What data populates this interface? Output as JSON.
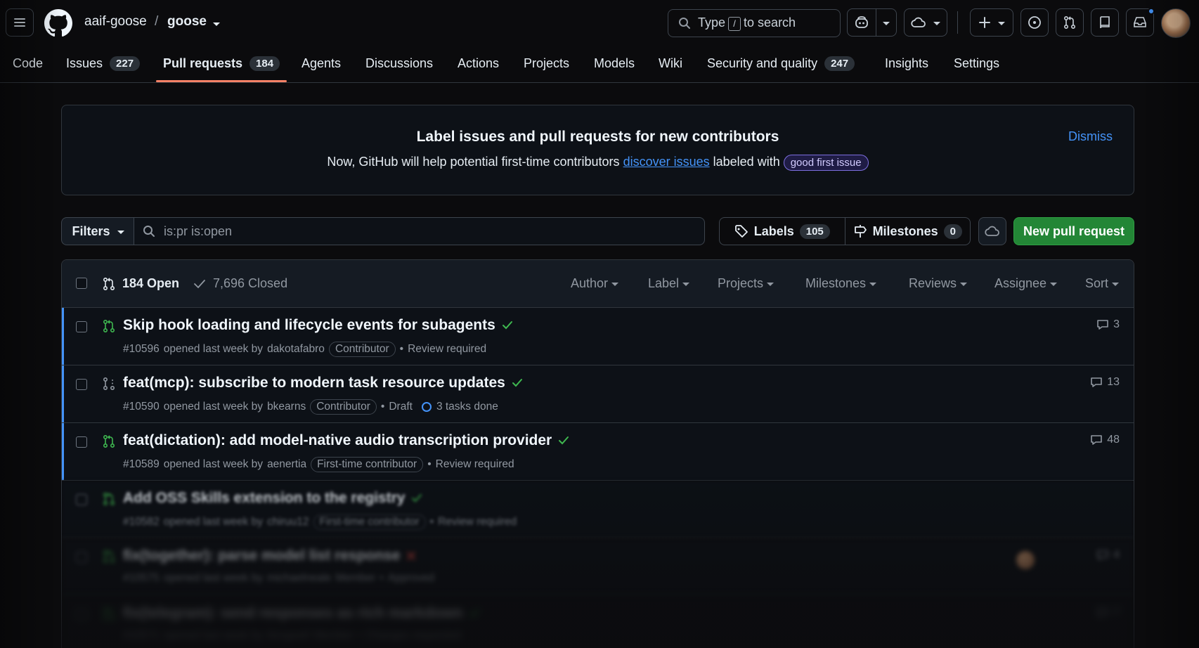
{
  "header": {
    "owner": "aaif-goose",
    "separator": "/",
    "repo": "goose",
    "search_prefix": "Type",
    "search_key": "/",
    "search_suffix": "to search"
  },
  "nav": {
    "items": [
      {
        "label": "Code"
      },
      {
        "label": "Issues",
        "count": "227"
      },
      {
        "label": "Pull requests",
        "count": "184"
      },
      {
        "label": "Agents"
      },
      {
        "label": "Discussions"
      },
      {
        "label": "Actions"
      },
      {
        "label": "Projects"
      },
      {
        "label": "Models"
      },
      {
        "label": "Wiki"
      },
      {
        "label": "Security and quality",
        "count": "247"
      },
      {
        "label": "Insights"
      },
      {
        "label": "Settings"
      }
    ]
  },
  "banner": {
    "title": "Label issues and pull requests for new contributors",
    "text_before": "Now, GitHub will help potential first-time contributors",
    "link": "discover issues",
    "text_after": "labeled with",
    "label": "good first issue",
    "dismiss": "Dismiss"
  },
  "filters": {
    "button": "Filters",
    "query": "is:pr is:open",
    "labels_label": "Labels",
    "labels_count": "105",
    "milestones_label": "Milestones",
    "milestones_count": "0",
    "new_pr": "New pull request"
  },
  "list_header": {
    "open": "184 Open",
    "closed": "7,696 Closed",
    "filters": [
      "Author",
      "Label",
      "Projects",
      "Milestones",
      "Reviews",
      "Assignee",
      "Sort"
    ]
  },
  "pull_requests": [
    {
      "title": "Skip hook loading and lifecycle events for subagents",
      "number": "#10596",
      "opened": "opened last week by",
      "author": "dakotafabro",
      "association": "Contributor",
      "status": "Review required",
      "extra": "",
      "comments": "3",
      "state": "open",
      "check": "pass"
    },
    {
      "title": "feat(mcp): subscribe to modern task resource updates",
      "number": "#10590",
      "opened": "opened last week by",
      "author": "bkearns",
      "association": "Contributor",
      "status": "Draft",
      "extra": "3 tasks done",
      "comments": "13",
      "state": "draft",
      "check": "pass"
    },
    {
      "title": "feat(dictation): add model-native audio transcription provider",
      "number": "#10589",
      "opened": "opened last week by",
      "author": "aenertia",
      "association": "First-time contributor",
      "status": "Review required",
      "extra": "",
      "comments": "48",
      "state": "open",
      "check": "pass"
    },
    {
      "title": "Add OSS Skills extension to the registry",
      "number": "#10582",
      "opened": "opened last week by",
      "author": "chiruu12",
      "association": "First-time contributor",
      "status": "Review required",
      "extra": "",
      "comments": "",
      "state": "open",
      "check": "pass"
    },
    {
      "title": "fix(together): parse model list response",
      "number": "#10575",
      "opened": "opened last week by",
      "author": "michaelneale",
      "association": "Member",
      "status": "Approved",
      "extra": "",
      "comments": "4",
      "state": "open",
      "check": "fail"
    },
    {
      "title": "fix(telegram): send responses as rich markdown",
      "number": "#10571",
      "opened": "opened last week by",
      "author": "tlongwell",
      "association": "Member",
      "status": "Changes requested",
      "extra": "",
      "comments": "7",
      "state": "open",
      "check": "pass"
    }
  ],
  "colors": {
    "accent_blue": "#4493f8",
    "open_green": "#3fb950",
    "fail_red": "#f85149",
    "primary_button": "#238636",
    "nav_underline": "#f78166"
  }
}
